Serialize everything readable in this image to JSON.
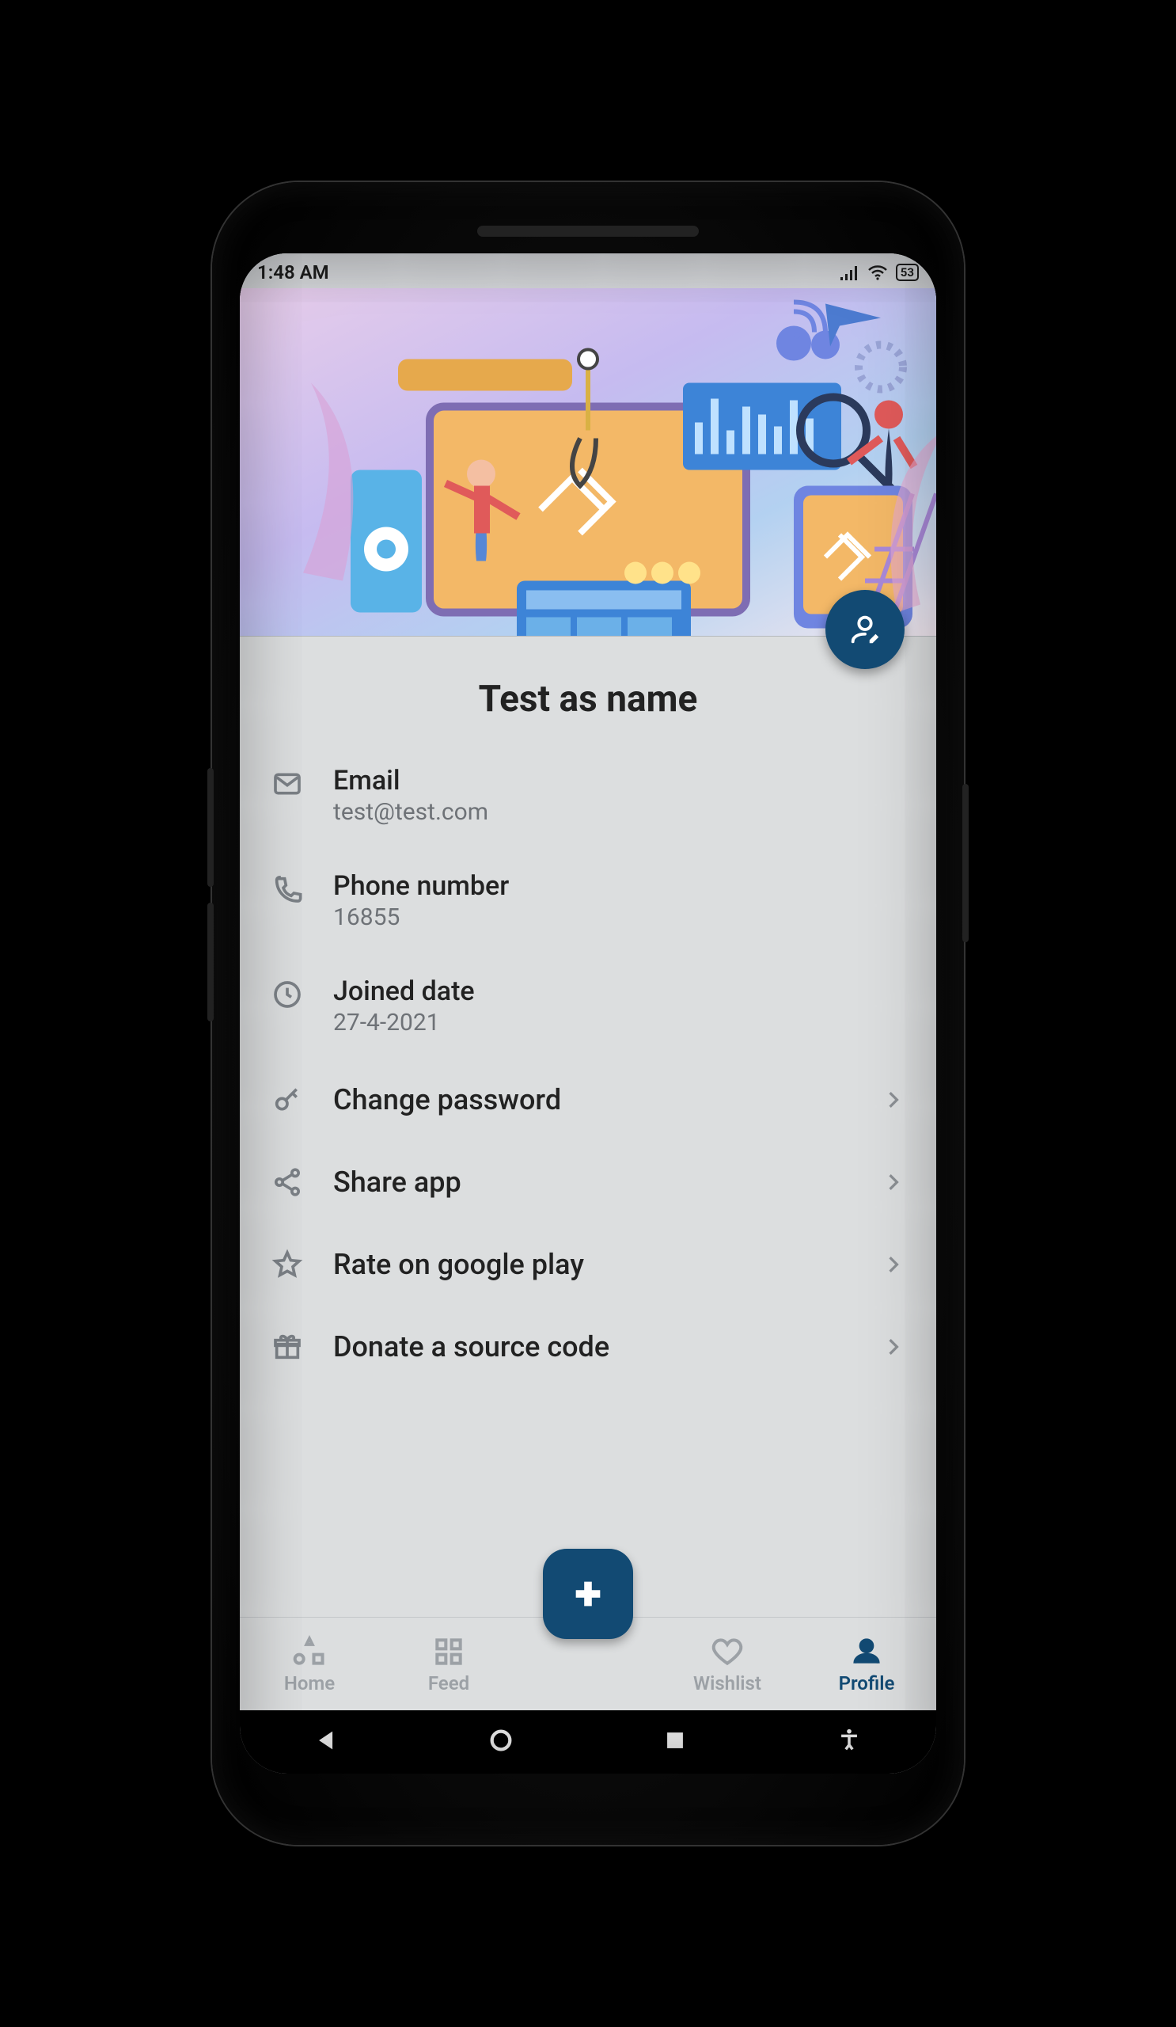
{
  "status": {
    "time": "1:48 AM",
    "battery": "53"
  },
  "profile": {
    "name": "Test as name",
    "fields": {
      "email": {
        "label": "Email",
        "value": "test@test.com"
      },
      "phone": {
        "label": "Phone number",
        "value": "16855"
      },
      "joined": {
        "label": "Joined date",
        "value": "27-4-2021"
      }
    }
  },
  "actions": {
    "change_password": "Change password",
    "share_app": "Share app",
    "rate": "Rate on google play",
    "donate": "Donate a source code"
  },
  "nav": {
    "home": "Home",
    "feed": "Feed",
    "wishlist": "Wishlist",
    "profile": "Profile"
  },
  "colors": {
    "accent": "#124a73"
  }
}
